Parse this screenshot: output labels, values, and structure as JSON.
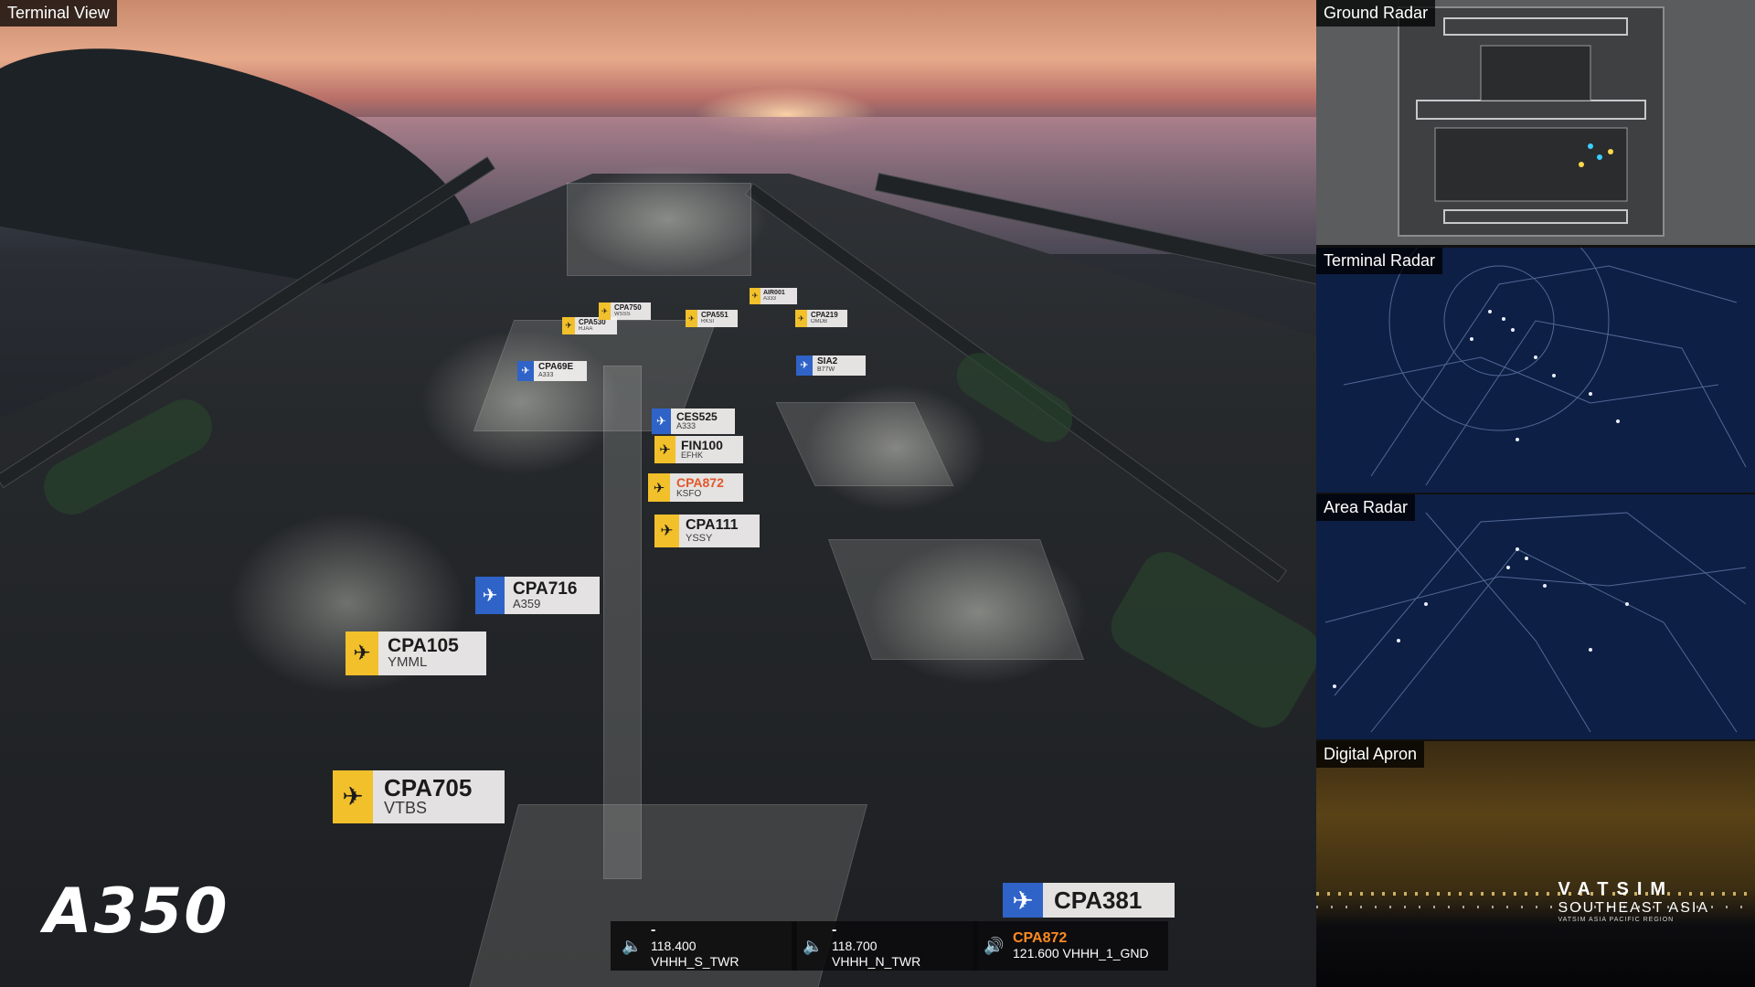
{
  "panels": {
    "terminal_view": "Terminal View",
    "ground_radar": "Ground Radar",
    "terminal_radar": "Terminal Radar",
    "area_radar": "Area Radar",
    "digital_apron": "Digital Apron"
  },
  "logo": "A350",
  "aircraft_tags": [
    {
      "callsign": "CPA705",
      "sub": "VTBS",
      "type": "departure",
      "alert": false
    },
    {
      "callsign": "CPA105",
      "sub": "YMML",
      "type": "departure",
      "alert": false
    },
    {
      "callsign": "CPA716",
      "sub": "A359",
      "type": "arrival",
      "alert": false
    },
    {
      "callsign": "CPA111",
      "sub": "YSSY",
      "type": "departure",
      "alert": false
    },
    {
      "callsign": "CPA872",
      "sub": "KSFO",
      "type": "departure",
      "alert": true
    },
    {
      "callsign": "FIN100",
      "sub": "EFHK",
      "type": "departure",
      "alert": false
    },
    {
      "callsign": "CES525",
      "sub": "A333",
      "type": "arrival",
      "alert": false
    },
    {
      "callsign": "SIA2",
      "sub": "B77W",
      "type": "arrival",
      "alert": false
    },
    {
      "callsign": "CPA69E",
      "sub": "A333",
      "type": "arrival",
      "alert": false
    },
    {
      "callsign": "CPA530",
      "sub": "RJAA",
      "type": "departure",
      "alert": false
    },
    {
      "callsign": "CPA750",
      "sub": "WSSS",
      "type": "departure",
      "alert": false
    },
    {
      "callsign": "CPA551",
      "sub": "RKSI",
      "type": "departure",
      "alert": false
    },
    {
      "callsign": "CPA219",
      "sub": "OMDB",
      "type": "departure",
      "alert": false
    },
    {
      "callsign": "AIR001",
      "sub": "A333",
      "type": "departure",
      "alert": false
    },
    {
      "callsign": "CPA381",
      "sub": "",
      "type": "arrival",
      "alert": false
    }
  ],
  "freq_controls": [
    {
      "callsign": "-",
      "freq": "118.400 VHHH_S_TWR",
      "speaker": "muted",
      "alert": false
    },
    {
      "callsign": "-",
      "freq": "118.700 VHHH_N_TWR",
      "speaker": "muted",
      "alert": false
    },
    {
      "callsign": "CPA872",
      "freq": "121.600 VHHH_1_GND",
      "speaker": "active",
      "alert": true
    }
  ],
  "vatsim": {
    "line1": "VATSIM",
    "line2": "SOUTHEAST ASIA",
    "line3": "VATSIM ASIA PACIFIC REGION"
  },
  "colors": {
    "departure_icon": "#f1c02b",
    "arrival_icon": "#2f63c8",
    "alert_text": "#e0582a",
    "radar_bg": "#0d1f44"
  }
}
